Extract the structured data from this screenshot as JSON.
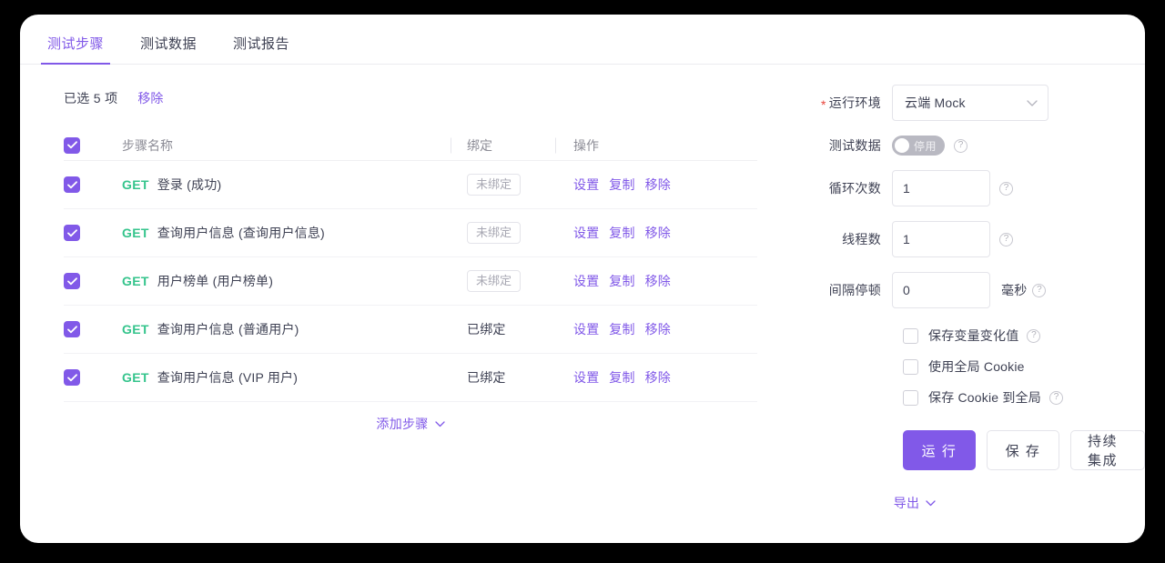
{
  "tabs": [
    {
      "label": "测试步骤",
      "active": true
    },
    {
      "label": "测试数据",
      "active": false
    },
    {
      "label": "测试报告",
      "active": false
    }
  ],
  "selection": {
    "count_label": "已选 5 项",
    "remove_label": "移除"
  },
  "table": {
    "headers": {
      "name": "步骤名称",
      "bind": "绑定",
      "action": "操作"
    },
    "header_checked": true,
    "rows": [
      {
        "checked": true,
        "method": "GET",
        "name": "登录 (成功)",
        "bind_label": "未绑定",
        "bound": false,
        "actions": [
          "设置",
          "复制",
          "移除"
        ]
      },
      {
        "checked": true,
        "method": "GET",
        "name": "查询用户信息 (查询用户信息)",
        "bind_label": "未绑定",
        "bound": false,
        "actions": [
          "设置",
          "复制",
          "移除"
        ]
      },
      {
        "checked": true,
        "method": "GET",
        "name": "用户榜单 (用户榜单)",
        "bind_label": "未绑定",
        "bound": false,
        "actions": [
          "设置",
          "复制",
          "移除"
        ]
      },
      {
        "checked": true,
        "method": "GET",
        "name": "查询用户信息 (普通用户)",
        "bind_label": "已绑定",
        "bound": true,
        "actions": [
          "设置",
          "复制",
          "移除"
        ]
      },
      {
        "checked": true,
        "method": "GET",
        "name": "查询用户信息 (VIP 用户)",
        "bind_label": "已绑定",
        "bound": true,
        "actions": [
          "设置",
          "复制",
          "移除"
        ]
      }
    ],
    "add_step_label": "添加步骤",
    "add_step_icon": "chevron-down-icon"
  },
  "settings": {
    "env": {
      "label": "运行环境",
      "required_mark": "*",
      "value": "云端 Mock",
      "caret_icon": "chevron-down-icon"
    },
    "test_data": {
      "label": "测试数据",
      "toggle_state_label": "停用",
      "enabled": false,
      "help_icon": "question-icon"
    },
    "loop_count": {
      "label": "循环次数",
      "value": "1",
      "help_icon": "question-icon"
    },
    "thread_count": {
      "label": "线程数",
      "value": "1",
      "help_icon": "question-icon"
    },
    "interval": {
      "label": "间隔停顿",
      "value": "0",
      "unit": "毫秒",
      "help_icon": "question-icon"
    },
    "checkboxes": [
      {
        "label": "保存变量变化值",
        "checked": false,
        "has_help": true
      },
      {
        "label": "使用全局 Cookie",
        "checked": false,
        "has_help": false
      },
      {
        "label": "保存 Cookie 到全局",
        "checked": false,
        "has_help": true
      }
    ],
    "buttons": [
      {
        "label": "运 行",
        "primary": true
      },
      {
        "label": "保 存",
        "primary": false
      },
      {
        "label": "持续集成",
        "primary": false
      }
    ],
    "export": {
      "label": "导出",
      "caret_icon": "chevron-down-icon"
    }
  },
  "colors": {
    "accent": "#8159e8",
    "method_get": "#35c48c",
    "required": "#e8453c",
    "text": "#3f4254",
    "muted": "#8c8c96",
    "border": "#e4e4ea",
    "page_bg": "#000000",
    "card_bg": "#ffffff"
  }
}
